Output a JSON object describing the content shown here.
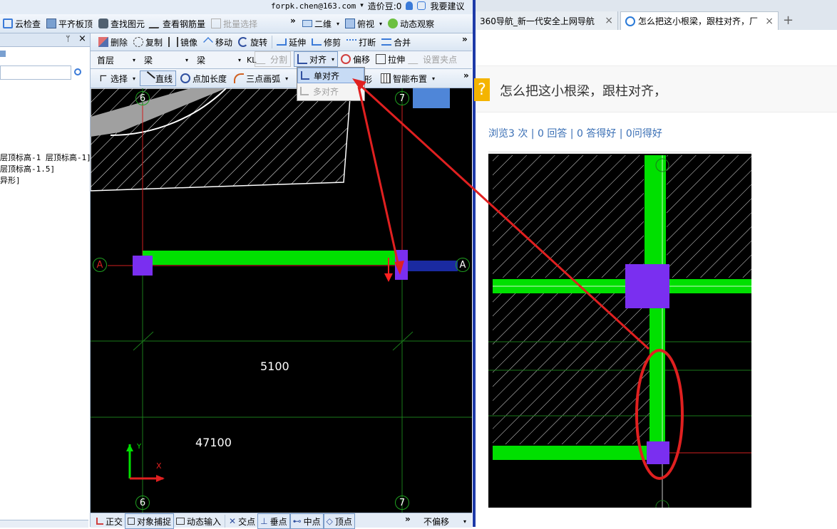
{
  "topbar": {
    "account": "forpk.chen@163.com",
    "dropdown": "▾",
    "zaojiadou": "造价豆:0",
    "suggest": "我要建议"
  },
  "toolbar1": {
    "items": [
      "云检查",
      "平齐板顶",
      "查找图元",
      "查看钢筋量",
      "批量选择"
    ],
    "view2d": "二维",
    "viewtop": "俯视",
    "dynamic": "动态观察"
  },
  "toolbar2": {
    "items": [
      "删除",
      "复制",
      "镜像",
      "移动",
      "旋转",
      "延伸",
      "修剪",
      "打断",
      "合并"
    ]
  },
  "toolbar3": {
    "floor": "首层",
    "type1": "梁",
    "type2": "梁",
    "kl": "KL",
    "split": "分割",
    "align": "对齐",
    "offset": "偏移",
    "stretch": "拉伸",
    "grip": "设置夹点"
  },
  "toolbar4": {
    "select": "选择",
    "line": "直线",
    "point_length": "点加长度",
    "arc": "三点画弧",
    "shape_partial": "形",
    "smart": "智能布置"
  },
  "align_menu": {
    "single": "单对齐",
    "multi": "多对齐"
  },
  "left_panel": {
    "lines": [
      "层顶标高-1 层顶标高-1]",
      "层顶标高-1.5]",
      "异形]"
    ]
  },
  "cad": {
    "axis_6": "6",
    "axis_7": "7",
    "axis_a": "A",
    "dim1": "5100",
    "dim2": "47100",
    "ucs_y": "Y",
    "ucs_x": "X"
  },
  "statusbar": {
    "items": [
      "正交",
      "对象捕捉",
      "动态输入",
      "交点",
      "垂点",
      "中点",
      "顶点"
    ],
    "offset": "不偏移"
  },
  "browser": {
    "tabs": [
      {
        "label": "360导航_新一代安全上网导航",
        "close": "×"
      },
      {
        "label": "怎么把这小根梁，跟柱对齐，厂",
        "close": "×"
      }
    ],
    "newtab": "+"
  },
  "question": {
    "title": "怎么把这小根梁，跟柱对齐，",
    "stats": "浏览3 次 | 0 回答 | 0 答得好 | 0问得好"
  },
  "colors": {
    "beam": "#00e000",
    "column": "#7a2ff0",
    "annotation": "#e02020",
    "gridline": "#1a7a1a",
    "axisline": "#d02020"
  }
}
